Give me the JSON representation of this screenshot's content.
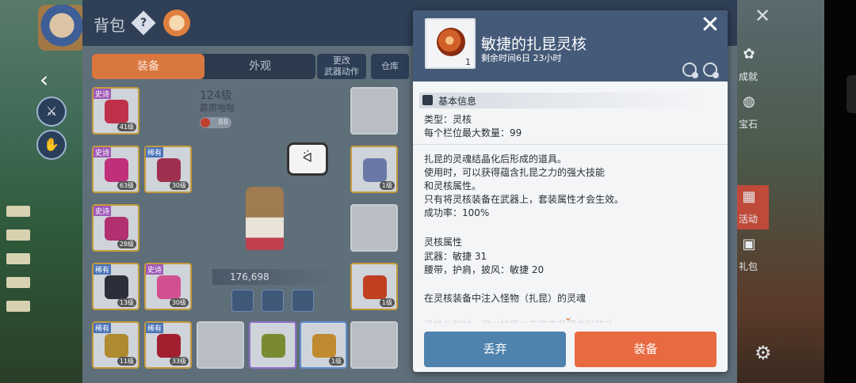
{
  "colors": {
    "popup_header": "#445a78",
    "discard_button": "#4f82ad",
    "equip_button": "#e86a40",
    "tab_active": "#d9773f"
  },
  "inventory": {
    "title": "背包",
    "help_icon": "?",
    "tabs": [
      {
        "label": "装备"
      },
      {
        "label": "外观"
      }
    ],
    "buttons": {
      "change_weapon_motion": "更改\n武器动作",
      "warehouse": "仓库"
    },
    "character": {
      "level": "124级",
      "name": "霹雳啪啦",
      "badge_value": "88",
      "power": "176,698"
    },
    "slots": [
      {
        "tag": "史诗",
        "level": "41级"
      },
      {
        "tag": "史诗",
        "level": "63级"
      },
      {
        "tag": "稀有",
        "level": "30级"
      },
      {
        "tag": "史诗",
        "level": "28级"
      },
      {
        "tag": "稀有",
        "level": "13级"
      },
      {
        "tag": "史诗",
        "level": "30级"
      },
      {
        "tag": "稀有",
        "level": "11级"
      },
      {
        "tag": "稀有",
        "level": "33级"
      },
      {
        "tag": "",
        "level": "1级"
      },
      {
        "tag": "",
        "level": "1级"
      },
      {
        "tag": "",
        "level": "1级"
      }
    ]
  },
  "sidebar": {
    "items": [
      {
        "label": "成就"
      },
      {
        "label": "宝石"
      },
      {
        "label": "活动"
      },
      {
        "label": "礼包"
      }
    ],
    "close_icon": "✕",
    "gear_icon": "⚙"
  },
  "popup": {
    "item_name": "敏捷的扎昆灵核",
    "item_count": "1",
    "time_remaining": "剩余时间6日 23小时",
    "close_icon": "✕",
    "section_title": "基本信息",
    "type_line": "类型：灵核",
    "max_slot_line": "每个栏位最大数量：99",
    "description": [
      "扎昆的灵魂结晶化后形成的道具。",
      "使用时，可以获得蕴含扎昆之力的强大技能",
      "和灵核属性。",
      "只有将灵核装备在武器上，套装属性才会生效。",
      "成功率：100%"
    ],
    "attr_title": "灵核属性",
    "attr_lines": [
      "武器：敏捷 31",
      "腰带，护肩，披风：敏捷 20"
    ],
    "inject_line": "在灵核装备中注入怪物（扎昆）的灵魂",
    "cut_line": "灵核分解时，可以按照以下概率获得各种碎片",
    "discard_label": "丢弃",
    "equip_label": "装备"
  }
}
